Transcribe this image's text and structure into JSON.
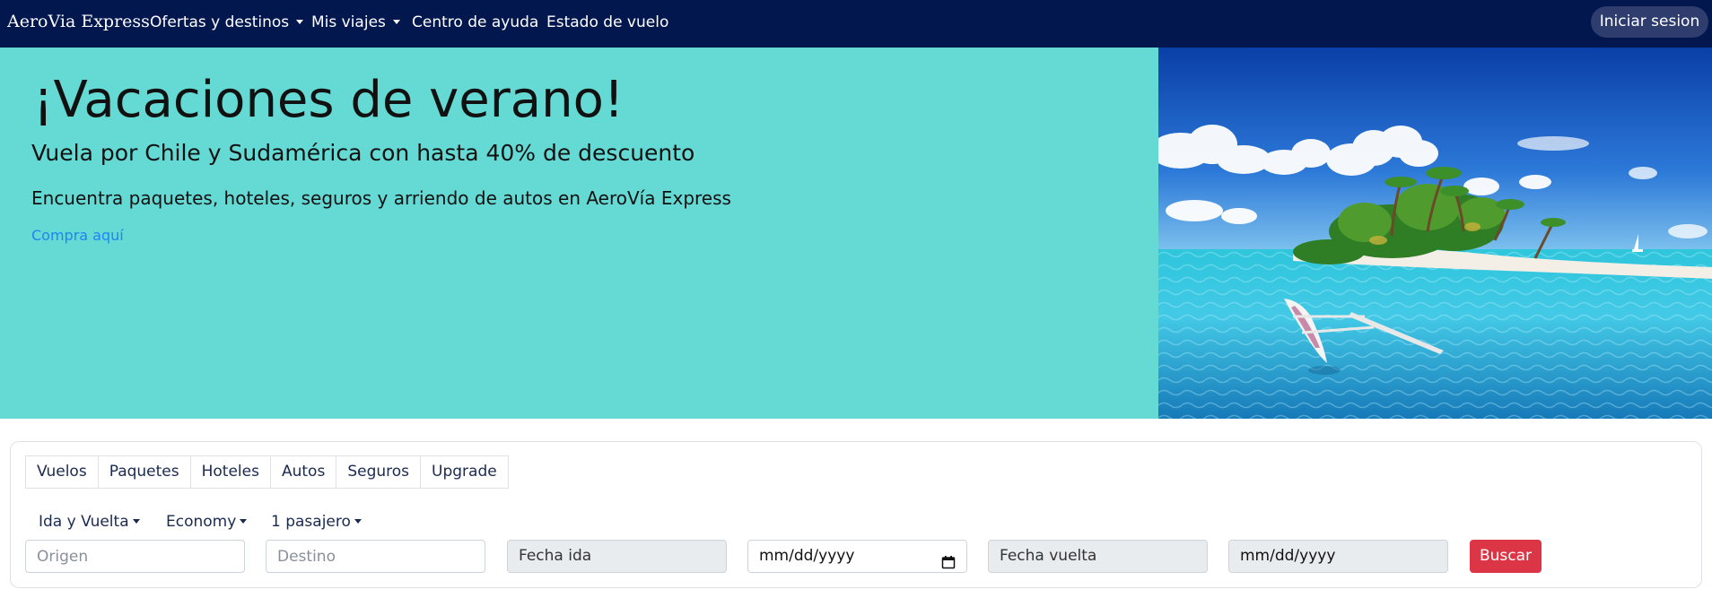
{
  "navbar": {
    "brand": "AeroVia Express",
    "items": [
      {
        "label": "Ofertas y destinos",
        "dropdown": true
      },
      {
        "label": "Mis viajes",
        "dropdown": true
      },
      {
        "label": "Centro de ayuda",
        "dropdown": false
      },
      {
        "label": "Estado de vuelo",
        "dropdown": false
      }
    ],
    "login_label": "Iniciar sesion"
  },
  "hero": {
    "title": "¡Vacaciones de verano!",
    "subtitle": "Vuela por Chile y Sudamérica con hasta 40% de descuento",
    "description": "Encuentra paquetes, hoteles, seguros y arriendo de autos en AeroVía Express",
    "link_label": "Compra aquí",
    "background_color": "#65d9d4"
  },
  "search": {
    "tabs": [
      "Vuelos",
      "Paquetes",
      "Hoteles",
      "Autos",
      "Seguros",
      "Upgrade"
    ],
    "trip_type": "Ida y Vuelta",
    "cabin_class": "Economy",
    "passengers": "1 pasajero",
    "origin_placeholder": "Origen",
    "destination_placeholder": "Destino",
    "depart_label": "Fecha ida",
    "depart_date_placeholder": "mm/dd/yyyy",
    "return_label": "Fecha vuelta",
    "return_date_placeholder": "mm/dd/yyyy",
    "search_button": "Buscar"
  },
  "colors": {
    "navbar": "#03174f",
    "accent_button": "#dc3545",
    "link": "#1f86f0"
  }
}
